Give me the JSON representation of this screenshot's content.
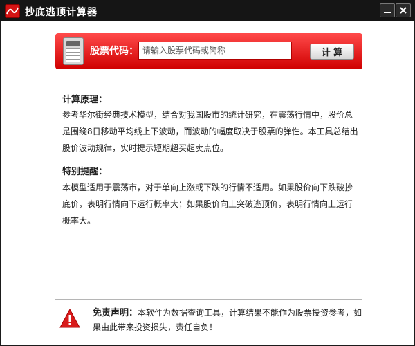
{
  "window": {
    "title": "抄底逃顶计算器"
  },
  "banner": {
    "label": "股票代码：",
    "input_value": "",
    "input_placeholder": "请输入股票代码或简称",
    "button_label": "计 算"
  },
  "sections": {
    "principle_title": "计算原理：",
    "principle_body": "参考华尔街经典技术模型，结合对我国股市的统计研究，在震荡行情中，股价总是围绕8日移动平均线上下波动，而波动的幅度取决于股票的弹性。本工具总结出股价波动规律，实时提示短期超买超卖点位。",
    "reminder_title": "特别提醒：",
    "reminder_body": "本模型适用于震荡市，对于单向上涨或下跌的行情不适用。如果股价向下跌破抄底价，表明行情向下运行概率大；如果股价向上突破逃顶价，表明行情向上运行概率大。"
  },
  "disclaimer": {
    "title": "免责声明：",
    "text": "本软件为数据查询工具，计算结果不能作为股票投资参考，如果由此带来投资损失，责任自负！"
  },
  "colors": {
    "banner_red": "#e01010",
    "titlebar": "#151515",
    "warning_red": "#d81b1b"
  },
  "icons": {
    "app": "app-logo-icon",
    "calculator": "calculator-icon",
    "minimize": "minimize-icon",
    "close": "close-icon",
    "warning": "warning-icon"
  }
}
